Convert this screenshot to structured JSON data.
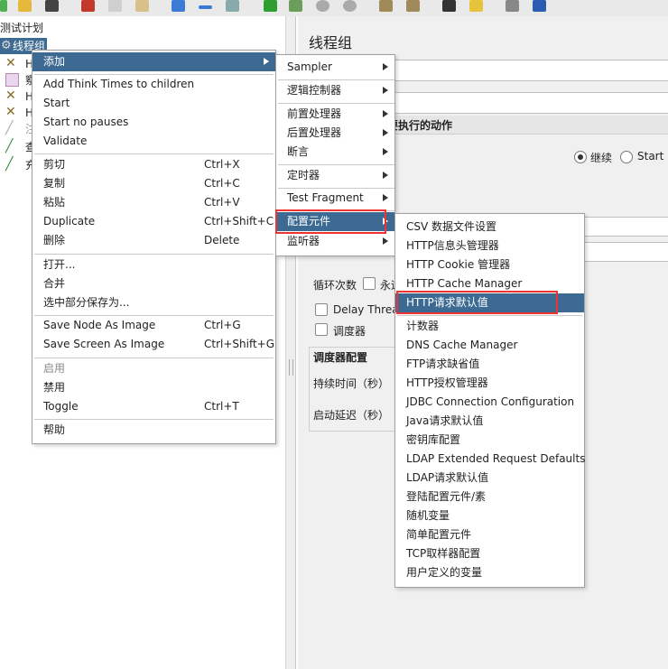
{
  "tree": {
    "root_label": "测试计划",
    "selected_label": "线程组",
    "child_initials": [
      "H",
      "察",
      "H",
      "H",
      "注",
      "查",
      "充"
    ]
  },
  "panel": {
    "title": "线程组",
    "error_action_heading": "要执行的动作",
    "radio_continue": "继续",
    "radio_start_next": "Start N",
    "loop_label": "循环次数",
    "loop_forever": "永远",
    "delay_thread": "Delay Thread",
    "scheduler": "调度器",
    "scheduler_config": "调度器配置",
    "duration": "持续时间（秒）",
    "startup_delay": "启动延迟（秒）"
  },
  "context_menu": {
    "add": "添加",
    "items": [
      {
        "label": "Add Think Times to children",
        "shortcut": ""
      },
      {
        "label": "Start",
        "shortcut": ""
      },
      {
        "label": "Start no pauses",
        "shortcut": ""
      },
      {
        "label": "Validate",
        "shortcut": ""
      },
      {
        "label": "剪切",
        "shortcut": "Ctrl+X"
      },
      {
        "label": "复制",
        "shortcut": "Ctrl+C"
      },
      {
        "label": "粘贴",
        "shortcut": "Ctrl+V"
      },
      {
        "label": "Duplicate",
        "shortcut": "Ctrl+Shift+C"
      },
      {
        "label": "删除",
        "shortcut": "Delete"
      },
      {
        "label": "打开...",
        "shortcut": ""
      },
      {
        "label": "合并",
        "shortcut": ""
      },
      {
        "label": "选中部分保存为...",
        "shortcut": ""
      },
      {
        "label": "Save Node As Image",
        "shortcut": "Ctrl+G"
      },
      {
        "label": "Save Screen As Image",
        "shortcut": "Ctrl+Shift+G"
      },
      {
        "label": "启用",
        "shortcut": ""
      },
      {
        "label": "禁用",
        "shortcut": ""
      },
      {
        "label": "Toggle",
        "shortcut": "Ctrl+T"
      },
      {
        "label": "帮助",
        "shortcut": ""
      }
    ]
  },
  "add_submenu": {
    "items": [
      "Sampler",
      "逻辑控制器",
      "前置处理器",
      "后置处理器",
      "断言",
      "定时器",
      "Test Fragment",
      "配置元件",
      "监听器"
    ],
    "selected": "配置元件"
  },
  "config_submenu": {
    "items": [
      "CSV 数据文件设置",
      "HTTP信息头管理器",
      "HTTP Cookie 管理器",
      "HTTP Cache Manager",
      "HTTP请求默认值",
      "计数器",
      "DNS Cache Manager",
      "FTP请求缺省值",
      "HTTP授权管理器",
      "JDBC Connection Configuration",
      "Java请求默认值",
      "密钥库配置",
      "LDAP Extended Request Defaults",
      "LDAP请求默认值",
      "登陆配置元件/素",
      "随机变量",
      "简单配置元件",
      "TCP取样器配置",
      "用户定义的变量"
    ],
    "selected": "HTTP请求默认值"
  },
  "colors": {
    "selection": "#3d6a92",
    "highlight_box": "#ee3333"
  }
}
